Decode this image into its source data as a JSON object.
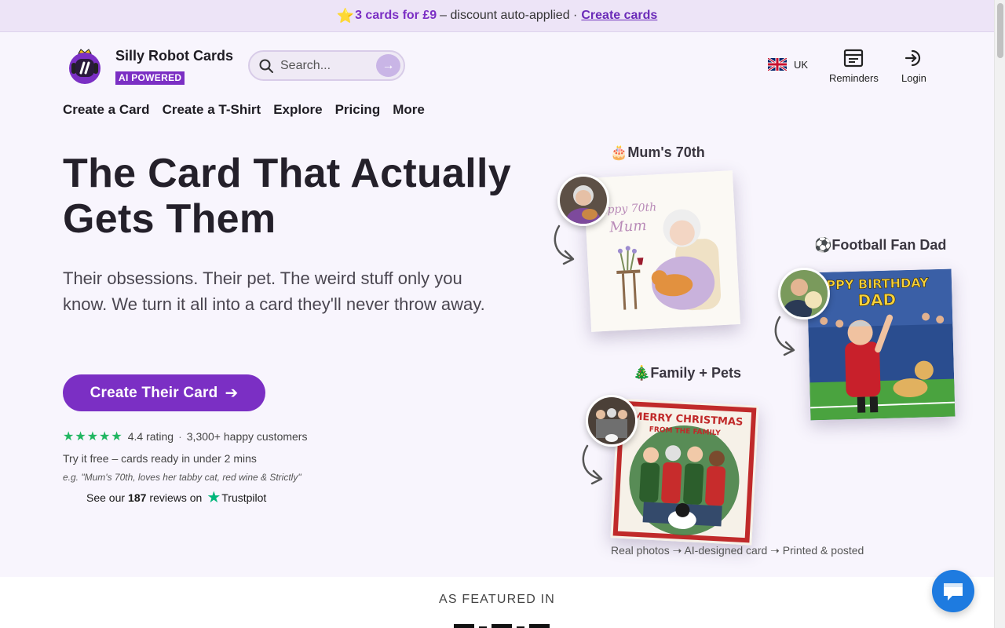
{
  "promo": {
    "star_icon": "star-icon",
    "highlight": "3 cards for £9",
    "text": "– discount auto-applied ·",
    "link": "Create cards"
  },
  "header": {
    "brand_name": "Silly Robot Cards",
    "brand_tag": "AI POWERED",
    "search_placeholder": "Search...",
    "locale": "UK",
    "reminders_label": "Reminders",
    "login_label": "Login"
  },
  "nav": {
    "items": [
      "Create a Card",
      "Create a T-Shirt",
      "Explore",
      "Pricing",
      "More"
    ]
  },
  "hero": {
    "title": "The Card That Actually Gets Them",
    "subtitle": "Their obsessions. Their pet. The weird stuff only you know. We turn it all into a card they'll never throw away.",
    "cta_label": "Create Their Card",
    "stars": "★★★★★",
    "rating_text": "4.4 rating",
    "customers_text": "3,300+ happy customers",
    "try_free": "Try it free – cards ready in under 2 mins",
    "example": "e.g. \"Mum's 70th, loves her tabby cat, red wine & Strictly\"",
    "trustpilot_prefix": "See our",
    "trustpilot_count": "187",
    "trustpilot_suffix": "reviews on",
    "trustpilot_brand": "Trustpilot"
  },
  "showcase": {
    "cards": [
      {
        "label": "🎂Mum's 70th",
        "card_text_1": "appy 70th",
        "card_text_2": "Mum"
      },
      {
        "label": "⚽Football Fan Dad",
        "card_text_1": "APPY BIRTHDAY",
        "card_text_2": "DAD"
      },
      {
        "label": "🎄Family + Pets",
        "card_text_1": "MERRY CHRISTMAS",
        "card_text_2": "FROM THE FAMILY"
      }
    ],
    "caption": "Real photos ➝ AI-designed card ➝ Printed & posted"
  },
  "featured": {
    "title": "AS FEATURED IN"
  },
  "colors": {
    "accent": "#7b2fc4",
    "promo_bg": "#ede4f7",
    "page_bg": "#f8f5fd",
    "trust_green": "#21b661",
    "chat_blue": "#1e7be0"
  }
}
